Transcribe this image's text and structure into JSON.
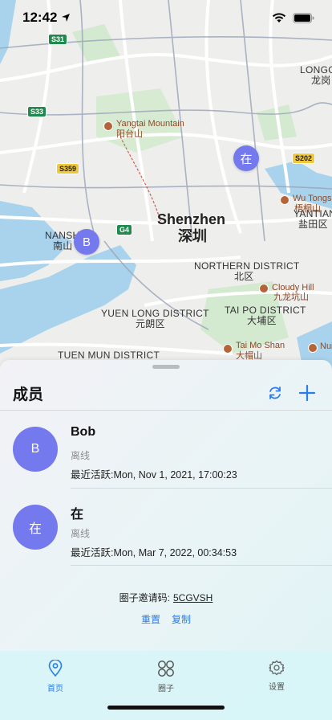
{
  "status_bar": {
    "time": "12:42"
  },
  "map": {
    "labels": {
      "shenzhen_en": "Shenzhen",
      "shenzhen_cn": "深圳",
      "nanshan_en": "NANSH",
      "nanshan_cn": "南山",
      "northern_en": "NORTHERN DISTRICT",
      "northern_cn": "北区",
      "yuenlong_en": "YUEN LONG DISTRICT",
      "yuenlong_cn": "元朗区",
      "taipo_en": "TAI PO DISTRICT",
      "taipo_cn": "大埔区",
      "tuenmun_en": "TUEN MUN DISTRICT",
      "yantian_en": "YANTIAN",
      "yantian_cn": "盐田区",
      "longgang_en": "LONGG",
      "longgang_cn": "龙岗",
      "yangtai_en": "Yangtai Mountain",
      "yangtai_cn": "阳台山",
      "wutong_en": "Wu Tongsh",
      "wutong_cn": "梧桐山",
      "cloudy_en": "Cloudy Hill",
      "cloudy_cn": "九龙坑山",
      "taimo_en": "Tai Mo Shan",
      "taimo_cn": "大帽山",
      "nui_en": "Nui"
    },
    "shields": {
      "s31": "S31",
      "s33": "S33",
      "s359": "S359",
      "s202": "S202",
      "g4": "G4"
    },
    "markers": {
      "zai": "在",
      "b": "B"
    }
  },
  "sheet": {
    "title": "成员",
    "members": [
      {
        "avatar": "B",
        "name": "Bob",
        "status": "离线",
        "last_active": "最近活跃:Mon, Nov 1, 2021, 17:00:23"
      },
      {
        "avatar": "在",
        "name": "在",
        "status": "离线",
        "last_active": "最近活跃:Mon, Mar 7, 2022, 00:34:53"
      }
    ],
    "invite_label": "圈子邀请码:",
    "invite_code": "5CGVSH",
    "reset_label": "重置",
    "copy_label": "复制"
  },
  "tabs": [
    {
      "label": "首页",
      "icon": "location-pin-icon"
    },
    {
      "label": "圈子",
      "icon": "circles-grid-icon"
    },
    {
      "label": "设置",
      "icon": "gear-icon"
    }
  ],
  "colors": {
    "accent": "#2b7de9",
    "avatar": "#7479ee"
  }
}
